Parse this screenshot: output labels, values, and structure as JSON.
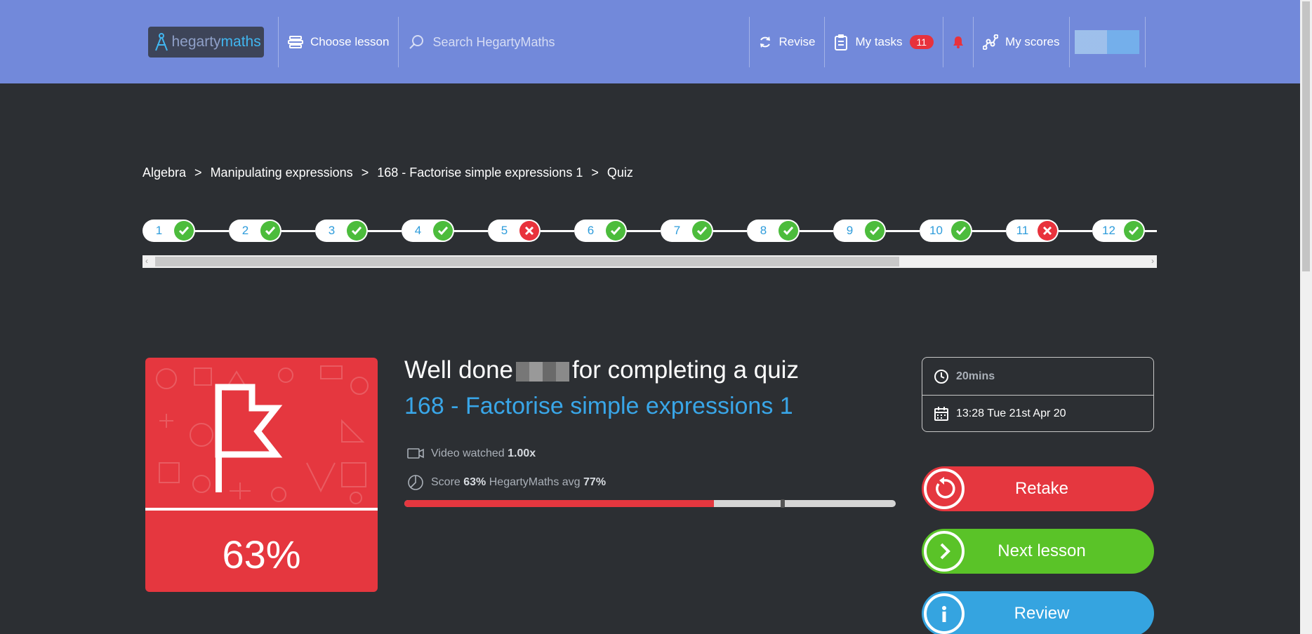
{
  "nav": {
    "logo_pre": "hegarty",
    "logo_post": "maths",
    "choose_lesson": "Choose lesson",
    "search_placeholder": "Search HegartyMaths",
    "revise": "Revise",
    "my_tasks": "My tasks",
    "tasks_count": "11",
    "my_scores": "My scores"
  },
  "breadcrumb": [
    "Algebra",
    "Manipulating expressions",
    "168 - Factorise simple expressions 1",
    "Quiz"
  ],
  "breadcrumb_sep": ">",
  "questions": [
    {
      "n": "1",
      "correct": true
    },
    {
      "n": "2",
      "correct": true
    },
    {
      "n": "3",
      "correct": true
    },
    {
      "n": "4",
      "correct": true
    },
    {
      "n": "5",
      "correct": false
    },
    {
      "n": "6",
      "correct": true
    },
    {
      "n": "7",
      "correct": true
    },
    {
      "n": "8",
      "correct": true
    },
    {
      "n": "9",
      "correct": true
    },
    {
      "n": "10",
      "correct": true
    },
    {
      "n": "11",
      "correct": false
    },
    {
      "n": "12",
      "correct": true
    }
  ],
  "result": {
    "percent": "63%",
    "headline_pre": "Well done",
    "headline_post": "for completing a quiz",
    "lesson_title": "168 - Factorise simple expressions 1",
    "video_label": "Video watched",
    "video_speed": "1.00x",
    "score_label": "Score",
    "score_value": "63%",
    "avg_label": "HegartyMaths avg",
    "avg_value": "77%",
    "score_fraction": 0.63,
    "avg_fraction": 0.77
  },
  "info": {
    "duration": "20mins",
    "datetime": "13:28 Tue 21st Apr 20"
  },
  "actions": {
    "retake": "Retake",
    "next": "Next lesson",
    "review": "Review"
  },
  "colors": {
    "nav": "#7289da",
    "bg": "#2c2f33",
    "red": "#e5373f",
    "green": "#5ac328",
    "blue": "#35a4e0",
    "link_blue": "#39a6e8"
  }
}
